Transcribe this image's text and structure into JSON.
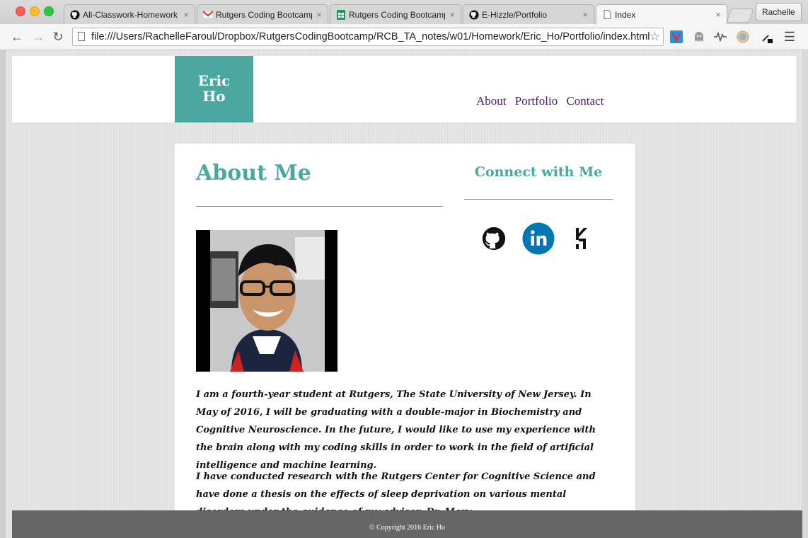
{
  "browser": {
    "tabs": [
      {
        "label": "All-Classwork-Homework",
        "icon": "github-icon"
      },
      {
        "label": "Rutgers Coding Bootcamp",
        "icon": "gmail-icon"
      },
      {
        "label": "Rutgers Coding Bootcamp",
        "icon": "sheets-icon"
      },
      {
        "label": "E-Hizzle/Portfolio",
        "icon": "github-icon"
      },
      {
        "label": "Index",
        "icon": "page-icon"
      }
    ],
    "profile_name": "Rachelle",
    "url": "file:///Users/RachelleFaroul/Dropbox/RutgersCodingBootcamp/RCB_TA_notes/w01/Homework/Eric_Ho/Portfolio/index.html"
  },
  "site": {
    "logo_line1": "Eric",
    "logo_line2": "Ho",
    "nav": [
      "About",
      "Portfolio",
      "Contact"
    ],
    "about_title": "About Me",
    "connect_title": "Connect with Me",
    "bio_paragraphs": [
      "I am a fourth-year student at Rutgers, The State University of New Jersey. In May of 2016, I will be graduating with a double-major in Biochemistry and Cognitive Neuroscience. In the future, I would like to use my experience with the brain along with my coding skills in order to work in the field of artificial intelligence and machine learning.",
      "I have conducted research with the Rutgers Center for Cognitive Science and have done a thesis on the effects of sleep deprivation on various mental disorders under the guidance of my advisor, Dr. Mary"
    ],
    "footer": "© Copyright 2016 Eric Ho"
  },
  "colors": {
    "accent": "#4aa8a1",
    "nav_link": "#4b1c6d",
    "linkedin": "#0077b5"
  }
}
